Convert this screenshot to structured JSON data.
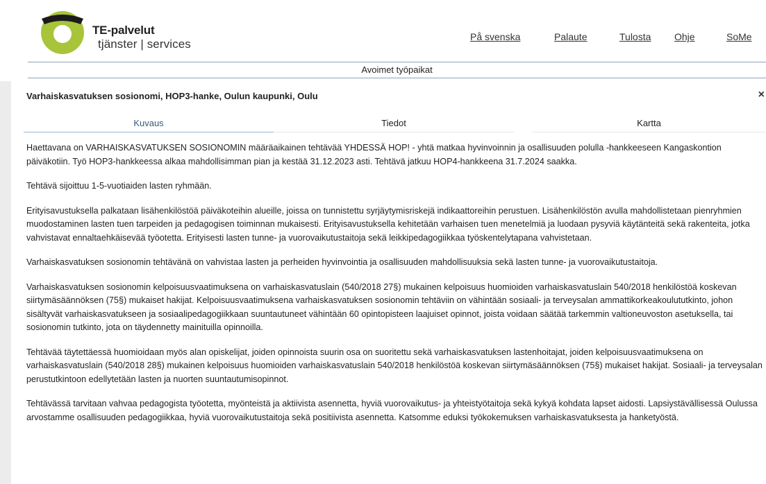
{
  "header": {
    "brand_name": "TE-palvelut",
    "brand_sub": "tjänster | services",
    "nav": [
      "På svenska",
      "Palaute",
      "Tulosta",
      "Ohje",
      "SoMe"
    ],
    "section_title": "Avoimet työpaikat",
    "logo_colors": {
      "green": "#a8c43a",
      "dark": "#1b1b1b"
    }
  },
  "job": {
    "title": "Varhaiskasvatuksen sosionomi, HOP3-hanke, Oulun kaupunki, Oulu",
    "close": "×"
  },
  "tabs": [
    {
      "label": "Kuvaus",
      "active": true
    },
    {
      "label": "Tiedot",
      "active": false
    },
    {
      "label": "Kartta",
      "active": false
    }
  ],
  "description": [
    "Haettavana on VARHAISKASVATUKSEN SOSIONOMIN määräaikainen tehtävää YHDESSÄ HOP! - yhtä matkaa hyvinvoinnin ja osallisuuden polulla -hankkeeseen Kangaskontion päiväkotiin. Työ HOP3-hankkeessa alkaa mahdollisimman pian ja kestää 31.12.2023 asti. Tehtävä jatkuu HOP4-hankkeena 31.7.2024 saakka.",
    "Tehtävä sijoittuu 1-5-vuotiaiden lasten ryhmään.",
    "Erityisavustuksella palkataan lisähenkilöstöä päiväkoteihin alueille, joissa on tunnistettu syrjäytymisriskejä indikaattoreihin perustuen. Lisähenkilöstön avulla mahdollistetaan pienryhmien muodostaminen lasten tuen tarpeiden ja pedagogisen toiminnan mukaisesti. Erityisavustuksella kehitetään varhaisen tuen menetelmiä ja luodaan pysyviä käytänteitä sekä rakenteita, jotka vahvistavat ennaltaehkäisevää työotetta. Erityisesti lasten tunne- ja vuorovaikutustaitoja sekä leikkipedagogiikkaa työskentelytapana vahvistetaan.",
    "Varhaiskasvatuksen sosionomin tehtävänä on vahvistaa lasten ja perheiden hyvinvointia ja osallisuuden mahdollisuuksia sekä lasten tunne- ja vuorovaikutustaitoja.",
    "Varhaiskasvatuksen sosionomin kelpoisuusvaatimuksena on varhaiskasvatuslain (540/2018 27§) mukainen kelpoisuus huomioiden varhaiskasvatuslain 540/2018 henkilöstöä koskevan siirtymäsäännöksen (75§) mukaiset hakijat. Kelpoisuusvaatimuksena varhaiskasvatuksen sosionomin tehtäviin on vähintään sosiaali- ja terveysalan ammattikorkeakoulututkinto, johon sisältyvät varhaiskasvatukseen ja sosiaalipedagogiikkaan suuntautuneet vähintään 60 opintopisteen laajuiset opinnot, joista voidaan säätää tarkemmin valtioneuvoston asetuksella, tai sosionomin tutkinto, jota on täydennetty mainituilla opinnoilla.",
    "Tehtävää täytettäessä huomioidaan myös alan opiskelijat, joiden opinnoista suurin osa on suoritettu sekä varhaiskasvatuksen lastenhoitajat, joiden kelpoisuusvaatimuksena on varhaiskasvatuslain (540/2018 28§) mukainen kelpoisuus huomioiden varhaiskasvatuslain 540/2018 henkilöstöä koskevan siirtymäsäännöksen (75§) mukaiset hakijat. Sosiaali- ja terveysalan perustutkintoon edellytetään lasten ja nuorten suuntautumisopinnot.",
    "Tehtävässä tarvitaan vahvaa pedagogista työotetta, myönteistä ja aktiivista asennetta, hyviä vuorovaikutus- ja yhteistyötaitoja sekä kykyä kohdata lapset aidosti. Lapsiystävällisessä Oulussa arvostamme osallisuuden pedagogiikkaa, hyviä vuorovaikutustaitoja sekä positiivista asennetta. Katsomme eduksi työkokemuksen varhaiskasvatuksesta ja hanketyöstä."
  ]
}
